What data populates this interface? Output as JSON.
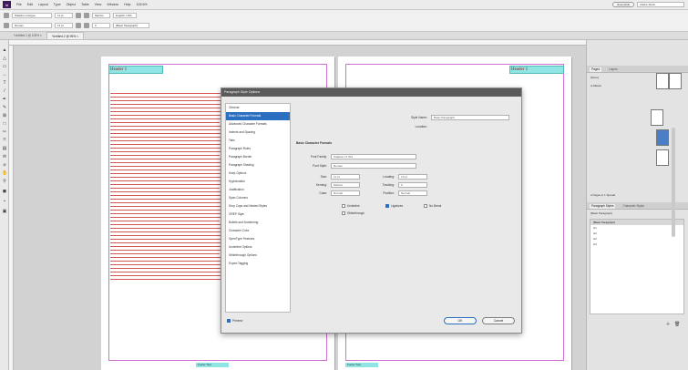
{
  "menubar": {
    "app_badge": "Id",
    "items": [
      "File",
      "Edit",
      "Layout",
      "Type",
      "Object",
      "Table",
      "View",
      "Window",
      "Help"
    ],
    "zoom": "105.6%",
    "workspace": "Essentials",
    "search_placeholder": "Adobe Stock"
  },
  "controlbar": {
    "font_name": "Palatino Linotype",
    "font_style": "Roman",
    "font_size": "11 pt",
    "leading": "13 pt",
    "kerning": "Metrics",
    "tracking": "0",
    "paragraph_style": "[Basic Paragraph]",
    "lang": "English: USA"
  },
  "document_tabs": [
    {
      "label": "*Untitled-1 @ 105% ×",
      "active": false
    },
    {
      "label": "*Untitled-2 @ 95% ×",
      "active": true
    }
  ],
  "page": {
    "header_left": "Header 1",
    "header_right": "Header 1",
    "footer_left": "Footer Text",
    "footer_right": "Footer Text"
  },
  "dialog": {
    "title": "Paragraph Style Options",
    "style_name_label": "Style Name:",
    "style_name_value": "Basic Paragraph",
    "location_label": "Location:",
    "section_title": "Basic Character Formats",
    "categories": [
      "General",
      "Basic Character Formats",
      "Advanced Character Formats",
      "Indents and Spacing",
      "Tabs",
      "Paragraph Rules",
      "Paragraph Border",
      "Paragraph Shading",
      "Keep Options",
      "Hyphenation",
      "Justification",
      "Span Columns",
      "Drop Caps and Nested Styles",
      "GREP Style",
      "Bullets and Numbering",
      "Character Color",
      "OpenType Features",
      "Underline Options",
      "Strikethrough Options",
      "Export Tagging"
    ],
    "selected_category_index": 1,
    "font_family_label": "Font Family:",
    "font_family_value": "Palatino LT Std",
    "font_style_label": "Font Style:",
    "font_style_value": "Roman",
    "size_label": "Size:",
    "size_value": "11 pt",
    "leading_label": "Leading:",
    "leading_value": "13 pt",
    "kerning_label": "Kerning:",
    "kerning_value": "Metrics",
    "tracking_label": "Tracking:",
    "tracking_value": "0",
    "case_label": "Case:",
    "case_value": "Normal",
    "position_label": "Position:",
    "position_value": "Normal",
    "underline_label": "Underline",
    "ligatures_label": "Ligatures",
    "no_break_label": "No Break",
    "strikethrough_label": "Strikethrough",
    "preview_label": "Preview",
    "ok_label": "OK",
    "cancel_label": "Cancel"
  },
  "panels": {
    "pages_tab": "Pages",
    "layers_tab": "Layers",
    "none_label": "[None]",
    "amaster_label": "A-Master",
    "styles_header": "Paragraph Styles",
    "styles_tab2": "Character Styles",
    "current_style": "[Basic Paragraph]",
    "style_items": [
      "[Basic Paragraph]",
      "H1",
      "H2",
      "H3",
      "H4"
    ],
    "pages_count": "2 Pages in 1 Spread"
  }
}
